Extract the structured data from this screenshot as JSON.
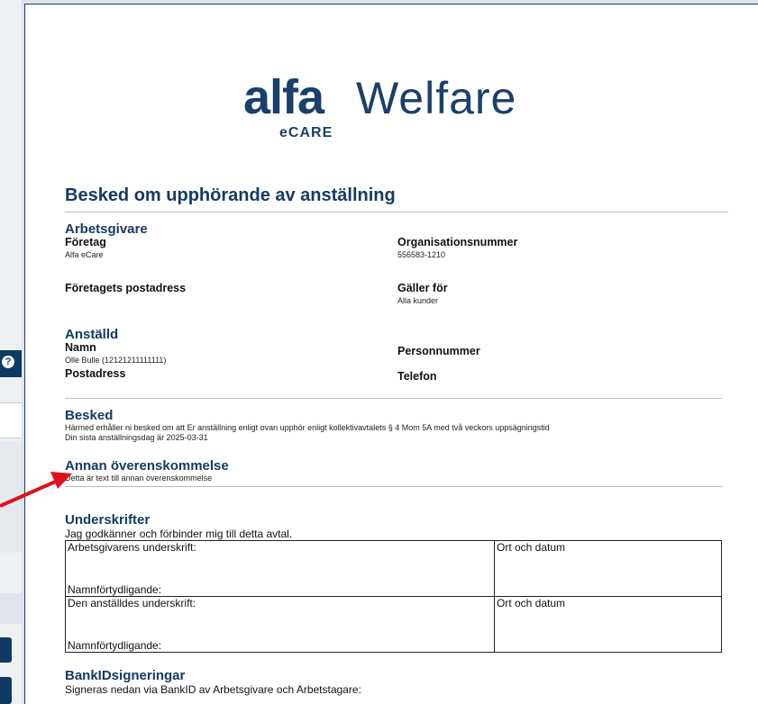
{
  "logo": {
    "brand": "alfa",
    "product": "Welfare",
    "sub": "eCARE"
  },
  "title": "Besked om upphörande av anställning",
  "arbetsgivare": {
    "heading": "Arbetsgivare",
    "foretag_label": "Företag",
    "foretag_value": "Alfa eCare",
    "orgnr_label": "Organisationsnummer",
    "orgnr_value": "556583-1210",
    "postadress_label": "Företagets postadress",
    "galler_label": "Gäller för",
    "galler_value": "Alla kunder"
  },
  "anstalld": {
    "heading": "Anställd",
    "namn_label": "Namn",
    "namn_value": "Olle Bulle (12121211111111)",
    "personnummer_label": "Personnummer",
    "postadress_label": "Postadress",
    "telefon_label": "Telefon"
  },
  "besked": {
    "heading": "Besked",
    "line1": "Härmed erhåller ni besked om att Er anställning enligt ovan upphör enligt kollektivavtalets § 4 Mom 5A med två veckors uppsägningstid",
    "line2": "Din sista anställningsdag är 2025-03-31"
  },
  "annan": {
    "heading": "Annan överenskommelse",
    "text": "Detta är text till annan överenskommelse"
  },
  "underskrifter": {
    "heading": "Underskrifter",
    "intro": "Jag godkänner och förbinder mig till detta avtal.",
    "rows": [
      {
        "signature": "Arbetsgivarens underskrift:",
        "clarify": "Namnförtydligande:",
        "place": "Ort och datum"
      },
      {
        "signature": "Den anställdes underskrift:",
        "clarify": "Namnförtydligande:",
        "place": "Ort och datum"
      }
    ]
  },
  "bankid": {
    "heading": "BankIDsigneringar",
    "text": "Signeras nedan via BankID av Arbetsgivare och Arbetstagare:"
  },
  "sidebar": {
    "help_icon": "?"
  },
  "colors": {
    "navy": "#163a63",
    "arrow": "#e0101a"
  }
}
